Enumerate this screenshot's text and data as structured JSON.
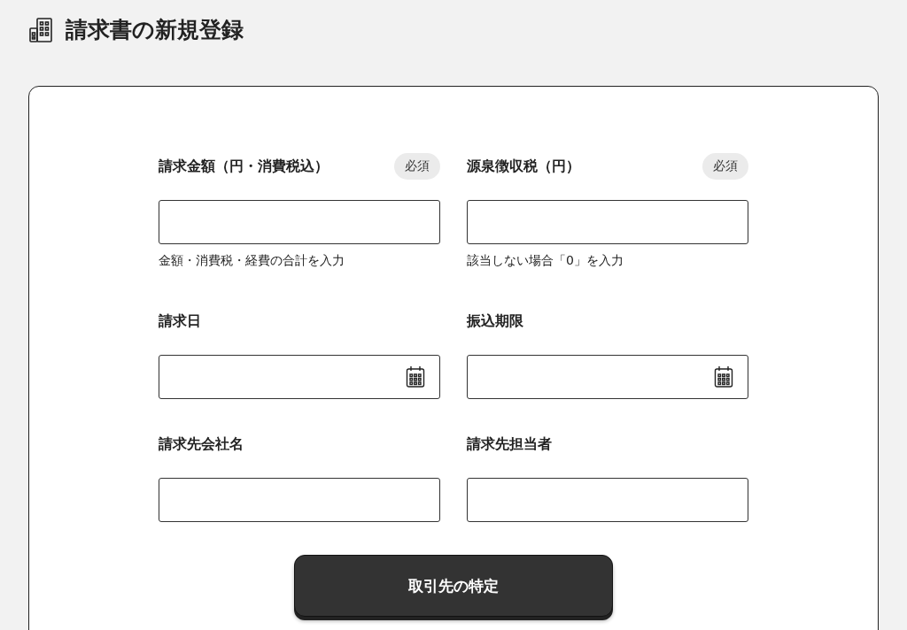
{
  "page": {
    "title": "請求書の新規登録"
  },
  "fields": [
    {
      "kind": "text",
      "label": "請求金額（円・消費税込）",
      "badge": "必須",
      "hint": "金額・消費税・経費の合計を入力"
    },
    {
      "kind": "text",
      "label": "源泉徴収税（円）",
      "badge": "必須",
      "hint": "該当しない場合「0」を入力"
    },
    {
      "kind": "date",
      "label": "請求日"
    },
    {
      "kind": "date",
      "label": "振込期限"
    },
    {
      "kind": "text",
      "label": "請求先会社名"
    },
    {
      "kind": "text",
      "label": "請求先担当者"
    }
  ],
  "button": {
    "label": "取引先の特定"
  }
}
